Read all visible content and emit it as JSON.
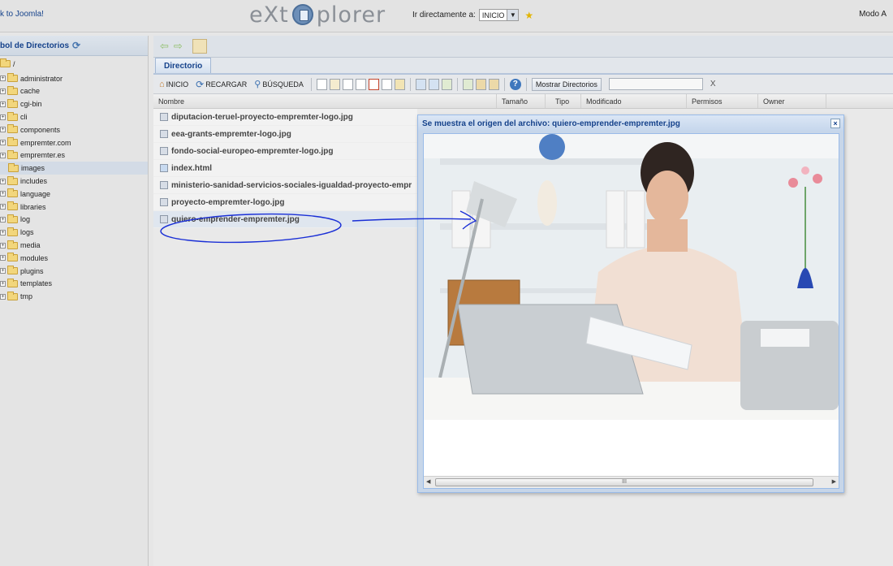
{
  "header": {
    "back_link": "k to Joomla!",
    "logo_left": "eXt",
    "logo_right": "plorer",
    "goto_label": "Ir directamente a:",
    "goto_value": "INICIO",
    "mode_text": "Modo A"
  },
  "tree": {
    "title": "bol de Directorios",
    "root": "/",
    "items": [
      {
        "label": "administrator",
        "selected": false
      },
      {
        "label": "cache",
        "selected": false
      },
      {
        "label": "cgi-bin",
        "selected": false
      },
      {
        "label": "cli",
        "selected": false
      },
      {
        "label": "components",
        "selected": false
      },
      {
        "label": "empremter.com",
        "selected": false
      },
      {
        "label": "empremter.es",
        "selected": false
      },
      {
        "label": "images",
        "selected": true
      },
      {
        "label": "includes",
        "selected": false
      },
      {
        "label": "language",
        "selected": false
      },
      {
        "label": "libraries",
        "selected": false
      },
      {
        "label": "log",
        "selected": false
      },
      {
        "label": "logs",
        "selected": false
      },
      {
        "label": "media",
        "selected": false
      },
      {
        "label": "modules",
        "selected": false
      },
      {
        "label": "plugins",
        "selected": false
      },
      {
        "label": "templates",
        "selected": false
      },
      {
        "label": "tmp",
        "selected": false
      }
    ]
  },
  "main": {
    "tab": "Directorio",
    "toolbar": {
      "home": "INICIO",
      "reload": "RECARGAR",
      "search": "BÚSQUEDA",
      "show_dirs": "Mostrar Directorios",
      "clear": "X"
    },
    "columns": {
      "name": "Nombre",
      "size": "Tamaño",
      "type": "Tipo",
      "modified": "Modificado",
      "perms": "Permisos",
      "owner": "Owner"
    },
    "files": [
      {
        "name": "diputacion-teruel-proyecto-empremter-logo.jpg",
        "kind": "image"
      },
      {
        "name": "eea-grants-empremter-logo.jpg",
        "kind": "image"
      },
      {
        "name": "fondo-social-europeo-empremter-logo.jpg",
        "kind": "image"
      },
      {
        "name": "index.html",
        "kind": "html"
      },
      {
        "name": "ministerio-sanidad-servicios-sociales-igualdad-proyecto-empr",
        "kind": "image"
      },
      {
        "name": "proyecto-empremter-logo.jpg",
        "kind": "image"
      },
      {
        "name": "quiero-emprender-empremter.jpg",
        "kind": "image",
        "selected": true
      }
    ]
  },
  "preview": {
    "title": "Se muestra el origen del archivo: quiero-emprender-empremter.jpg",
    "close": "×",
    "scroll_grip": "III"
  },
  "colors": {
    "accent": "#15428b",
    "annotation": "#1a2fd6"
  }
}
